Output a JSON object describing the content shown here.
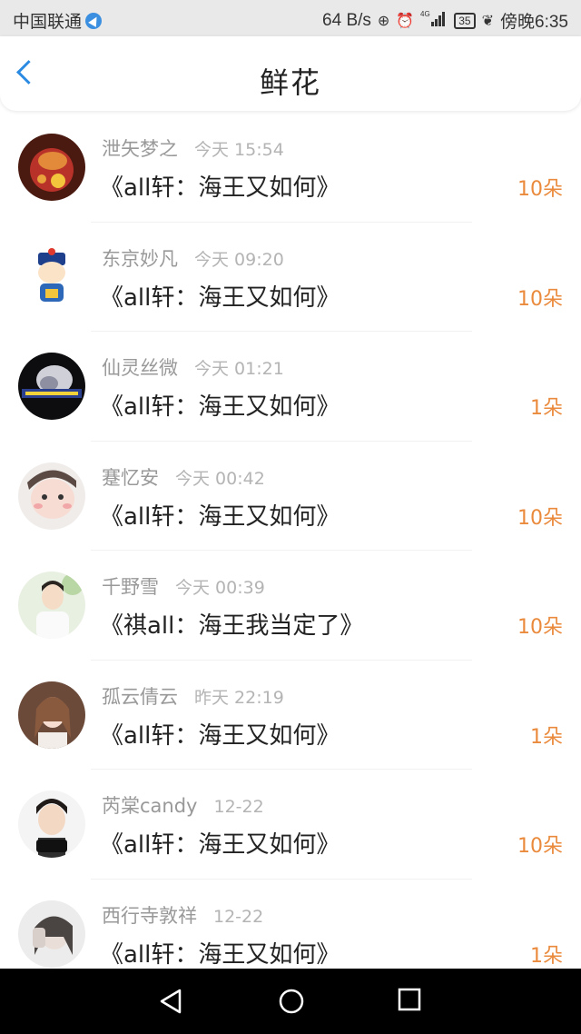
{
  "status_bar": {
    "carrier": "中国联通",
    "speed": "64 B/s",
    "network": "4G",
    "battery": "35",
    "time": "傍晚6:35"
  },
  "header": {
    "title": "鲜花"
  },
  "colors": {
    "accent": "#2b8ae2",
    "amount": "#ea8a3c"
  },
  "items": [
    {
      "name": "泄矢梦之",
      "time": "今天 15:54",
      "book": "《all轩：海王又如何》",
      "amount": "10朵"
    },
    {
      "name": "东京妙凡",
      "time": "今天 09:20",
      "book": "《all轩：海王又如何》",
      "amount": "10朵"
    },
    {
      "name": "仙灵丝微",
      "time": "今天 01:21",
      "book": "《all轩：海王又如何》",
      "amount": "1朵"
    },
    {
      "name": "蹇忆安",
      "time": "今天 00:42",
      "book": "《all轩：海王又如何》",
      "amount": "10朵"
    },
    {
      "name": "千野雪",
      "time": "今天 00:39",
      "book": "《祺all：海王我当定了》",
      "amount": "10朵"
    },
    {
      "name": "孤云倩云",
      "time": "昨天 22:19",
      "book": "《all轩：海王又如何》",
      "amount": "1朵"
    },
    {
      "name": "芮棠candy",
      "time": "12-22",
      "book": "《all轩：海王又如何》",
      "amount": "10朵"
    },
    {
      "name": "西行寺敦祥",
      "time": "12-22",
      "book": "《all轩：海王又如何》",
      "amount": "1朵"
    }
  ]
}
